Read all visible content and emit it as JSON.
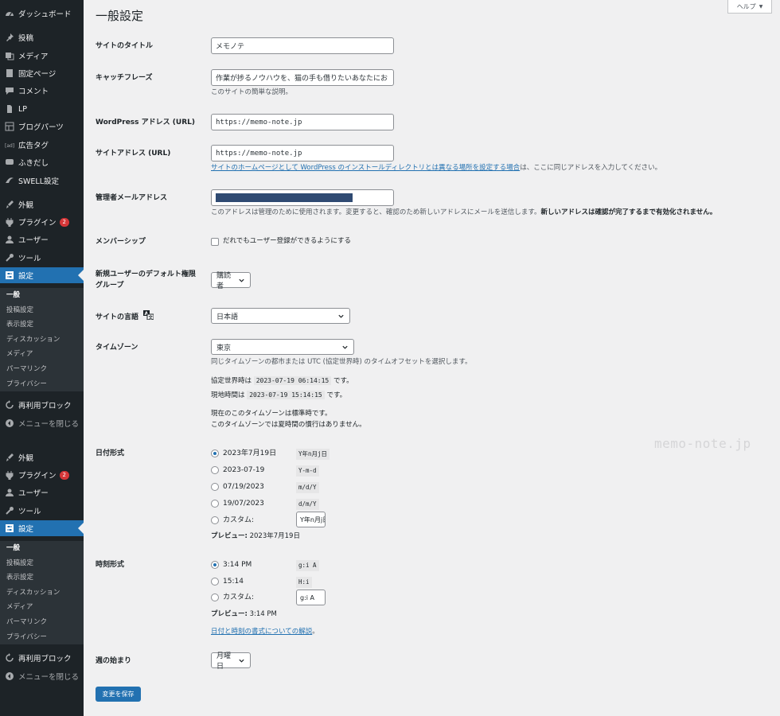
{
  "sidebar": {
    "items": [
      {
        "label": "ダッシュボード",
        "icon": "dashboard-icon"
      },
      {
        "label": "投稿",
        "icon": "pin-icon"
      },
      {
        "label": "メディア",
        "icon": "media-icon"
      },
      {
        "label": "固定ページ",
        "icon": "page-icon"
      },
      {
        "label": "コメント",
        "icon": "comment-icon"
      },
      {
        "label": "LP",
        "icon": "document-icon"
      },
      {
        "label": "ブログパーツ",
        "icon": "grid-icon"
      },
      {
        "label": "広告タグ",
        "icon": "ad-icon"
      },
      {
        "label": "ふきだし",
        "icon": "chat-icon"
      },
      {
        "label": "SWELL設定",
        "icon": "swell-icon"
      }
    ],
    "groups": [
      {
        "appearance": "外観",
        "plugins": "プラグイン",
        "plugins_badge": "2",
        "users": "ユーザー",
        "tools": "ツール",
        "settings": "設定",
        "submenu": [
          "一般",
          "投稿設定",
          "表示設定",
          "ディスカッション",
          "メディア",
          "パーマリンク",
          "プライバシー"
        ],
        "reusable_blocks": "再利用ブロック",
        "collapse": "メニューを閉じる"
      },
      {
        "appearance": "外観",
        "plugins": "プラグイン",
        "plugins_badge": "2",
        "users": "ユーザー",
        "tools": "ツール",
        "settings": "設定",
        "submenu": [
          "一般",
          "投稿設定",
          "表示設定",
          "ディスカッション",
          "メディア",
          "パーマリンク",
          "プライバシー"
        ],
        "reusable_blocks": "再利用ブロック",
        "collapse": "メニューを閉じる"
      }
    ]
  },
  "header": {
    "title": "一般設定",
    "help": "ヘルプ"
  },
  "form": {
    "site_title": {
      "label": "サイトのタイトル",
      "value": "メモノテ"
    },
    "tagline": {
      "label": "キャッチフレーズ",
      "value": "作業が捗るノウハウを、猫の手も借りたいあなたにお",
      "desc": "このサイトの簡単な説明。"
    },
    "wp_address": {
      "label": "WordPress アドレス (URL)",
      "value": "https://memo-note.jp"
    },
    "site_address": {
      "label": "サイトアドレス (URL)",
      "value": "https://memo-note.jp",
      "desc_link": "サイトのホームページとして WordPress のインストールディレクトリとは異なる場所を設定する場合",
      "desc_rest": "は、ここに同じアドレスを入力してください。"
    },
    "admin_email": {
      "label": "管理者メールアドレス",
      "desc": "このアドレスは管理のために使用されます。変更すると、確認のため新しいアドレスにメールを送信します。",
      "desc_bold": "新しいアドレスは確認が完了するまで有効化されません。",
      "redaction_color": "#2f4a72"
    },
    "membership": {
      "label": "メンバーシップ",
      "checkbox": "だれでもユーザー登録ができるようにする"
    },
    "default_role": {
      "label_line1": "新規ユーザーのデフォルト権限",
      "label_line2": "グループ",
      "value": "購読者"
    },
    "language": {
      "label": "サイトの言語",
      "value": "日本語"
    },
    "timezone": {
      "label": "タイムゾーン",
      "value": "東京",
      "desc": "同じタイムゾーンの都市または UTC (協定世界時) のタイムオフセットを選択します。",
      "utc_prefix": "協定世界時は",
      "utc_value": "2023-07-19 06:14:15",
      "utc_suffix": "です。",
      "local_prefix": "現地時間は",
      "local_value": "2023-07-19 15:14:15",
      "local_suffix": "です。",
      "note1": "現在のこのタイムゾーンは標準時です。",
      "note2": "このタイムゾーンでは夏時間の慣行はありません。"
    },
    "date_format": {
      "label": "日付形式",
      "options": [
        {
          "label": "2023年7月19日",
          "code": "Y年n月j日"
        },
        {
          "label": "2023-07-19",
          "code": "Y-m-d"
        },
        {
          "label": "07/19/2023",
          "code": "m/d/Y"
        },
        {
          "label": "19/07/2023",
          "code": "d/m/Y"
        }
      ],
      "custom_label": "カスタム:",
      "custom_value": "Y年n月j日",
      "preview_label": "プレビュー:",
      "preview_value": "2023年7月19日"
    },
    "time_format": {
      "label": "時刻形式",
      "options": [
        {
          "label": "3:14 PM",
          "code": "g:i A"
        },
        {
          "label": "15:14",
          "code": "H:i"
        }
      ],
      "custom_label": "カスタム:",
      "custom_value": "g:i A",
      "preview_label": "プレビュー:",
      "preview_value": "3:14 PM",
      "doc_link": "日付と時刻の書式についての解説",
      "doc_suffix": "。"
    },
    "week_start": {
      "label": "週の始まり",
      "value": "月曜日"
    },
    "save": "変更を保存"
  },
  "watermark": "memo-note.jp",
  "colors": {
    "sidebar": "#1d2327",
    "accent": "#2271b1",
    "badge": "#d63638"
  }
}
